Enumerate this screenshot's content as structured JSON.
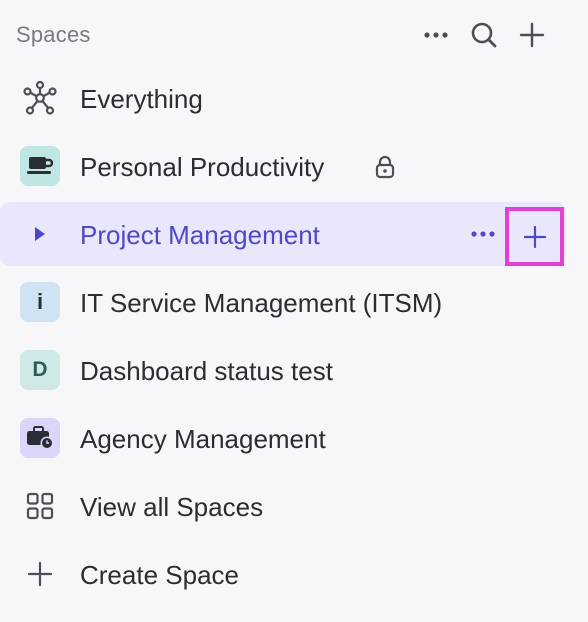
{
  "header": {
    "title": "Spaces",
    "more_icon": "ellipsis-icon",
    "search_icon": "search-icon",
    "add_icon": "plus-icon"
  },
  "items": [
    {
      "label": "Everything",
      "icon": "hub-icon"
    },
    {
      "label": "Personal Productivity",
      "icon": "coffee-cup-icon",
      "icon_bg": "#bfe6e3",
      "locked": true
    },
    {
      "label": "Project Management",
      "icon": "caret-right-icon",
      "active": true
    },
    {
      "label": "IT Service Management (ITSM)",
      "avatar_text": "i",
      "icon_bg": "#cfe3f5"
    },
    {
      "label": "Dashboard status test",
      "avatar_text": "D",
      "icon_bg": "#cfe9e6"
    },
    {
      "label": "Agency Management",
      "icon": "briefcase-clock-icon",
      "icon_bg": "#d9d6fa"
    },
    {
      "label": "View all Spaces",
      "icon": "grid-icon"
    },
    {
      "label": "Create Space",
      "icon": "plus-icon"
    }
  ],
  "colors": {
    "background": "#f7f7f9",
    "active_bg": "#e9e7fb",
    "active_text": "#5048c4",
    "highlight_box": "#e23fd4"
  }
}
